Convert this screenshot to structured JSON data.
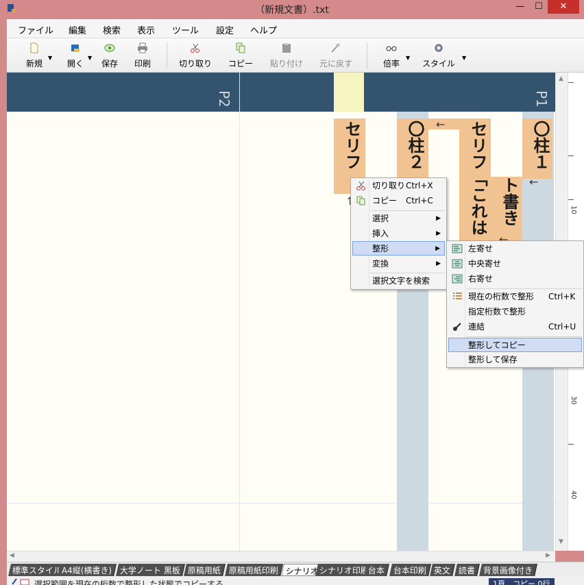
{
  "window": {
    "title": "（新規文書）.txt",
    "min_glyph": "—",
    "max_glyph": "☐",
    "close_glyph": "✕"
  },
  "menu": [
    "ファイル",
    "編集",
    "検索",
    "表示",
    "ツール",
    "設定",
    "ヘルプ"
  ],
  "toolbar": {
    "new": "新規",
    "open": "開く",
    "save": "保存",
    "print": "印刷",
    "cut": "切り取り",
    "copy": "コピー",
    "paste": "貼り付け",
    "undo": "元に戻す",
    "zoom": "倍率",
    "style": "スタイル",
    "drop_glyph": "▼"
  },
  "editor": {
    "page1_label": "P1",
    "page2_label": "P2",
    "col_pillar1": "〇柱１",
    "col_dialog1": "セリフ「これは",
    "col_togaki": "ト書き",
    "col_pillar2": "〇柱２",
    "col_dialog2": "セリフ",
    "arrow_left": "←",
    "arrow_up": "↑",
    "ruler_marks": [
      "10",
      "30",
      "40"
    ]
  },
  "context_menu": {
    "cut": "切り取り",
    "cut_key": "Ctrl+X",
    "copy": "コピー",
    "copy_key": "Ctrl+C",
    "select": "選択",
    "insert": "挿入",
    "format": "整形",
    "convert": "変換",
    "search_selected": "選択文字を検索",
    "submenu_glyph": "▶"
  },
  "format_submenu": {
    "align_left": "左寄せ",
    "align_center": "中央寄せ",
    "align_right": "右寄せ",
    "format_current": "現在の桁数で整形",
    "format_current_key": "Ctrl+K",
    "format_specified": "指定桁数で整形",
    "join": "連結",
    "join_key": "Ctrl+U",
    "format_copy": "整形してコピー",
    "format_save": "整形して保存"
  },
  "style_tabs": [
    "標準スタイル",
    "A4縦(横書き)",
    "大学ノート",
    "黒板",
    "原稿用紙",
    "原稿用紙印刷",
    "シナリオ",
    "シナリオ印刷",
    "台本",
    "台本印刷",
    "英文",
    "読書",
    "背景画像付き"
  ],
  "active_tab": "シナリオ",
  "status": {
    "text": "選択範囲を現在の桁数で整形した状態でコピーする",
    "right": "1頁　コピー 0行"
  }
}
